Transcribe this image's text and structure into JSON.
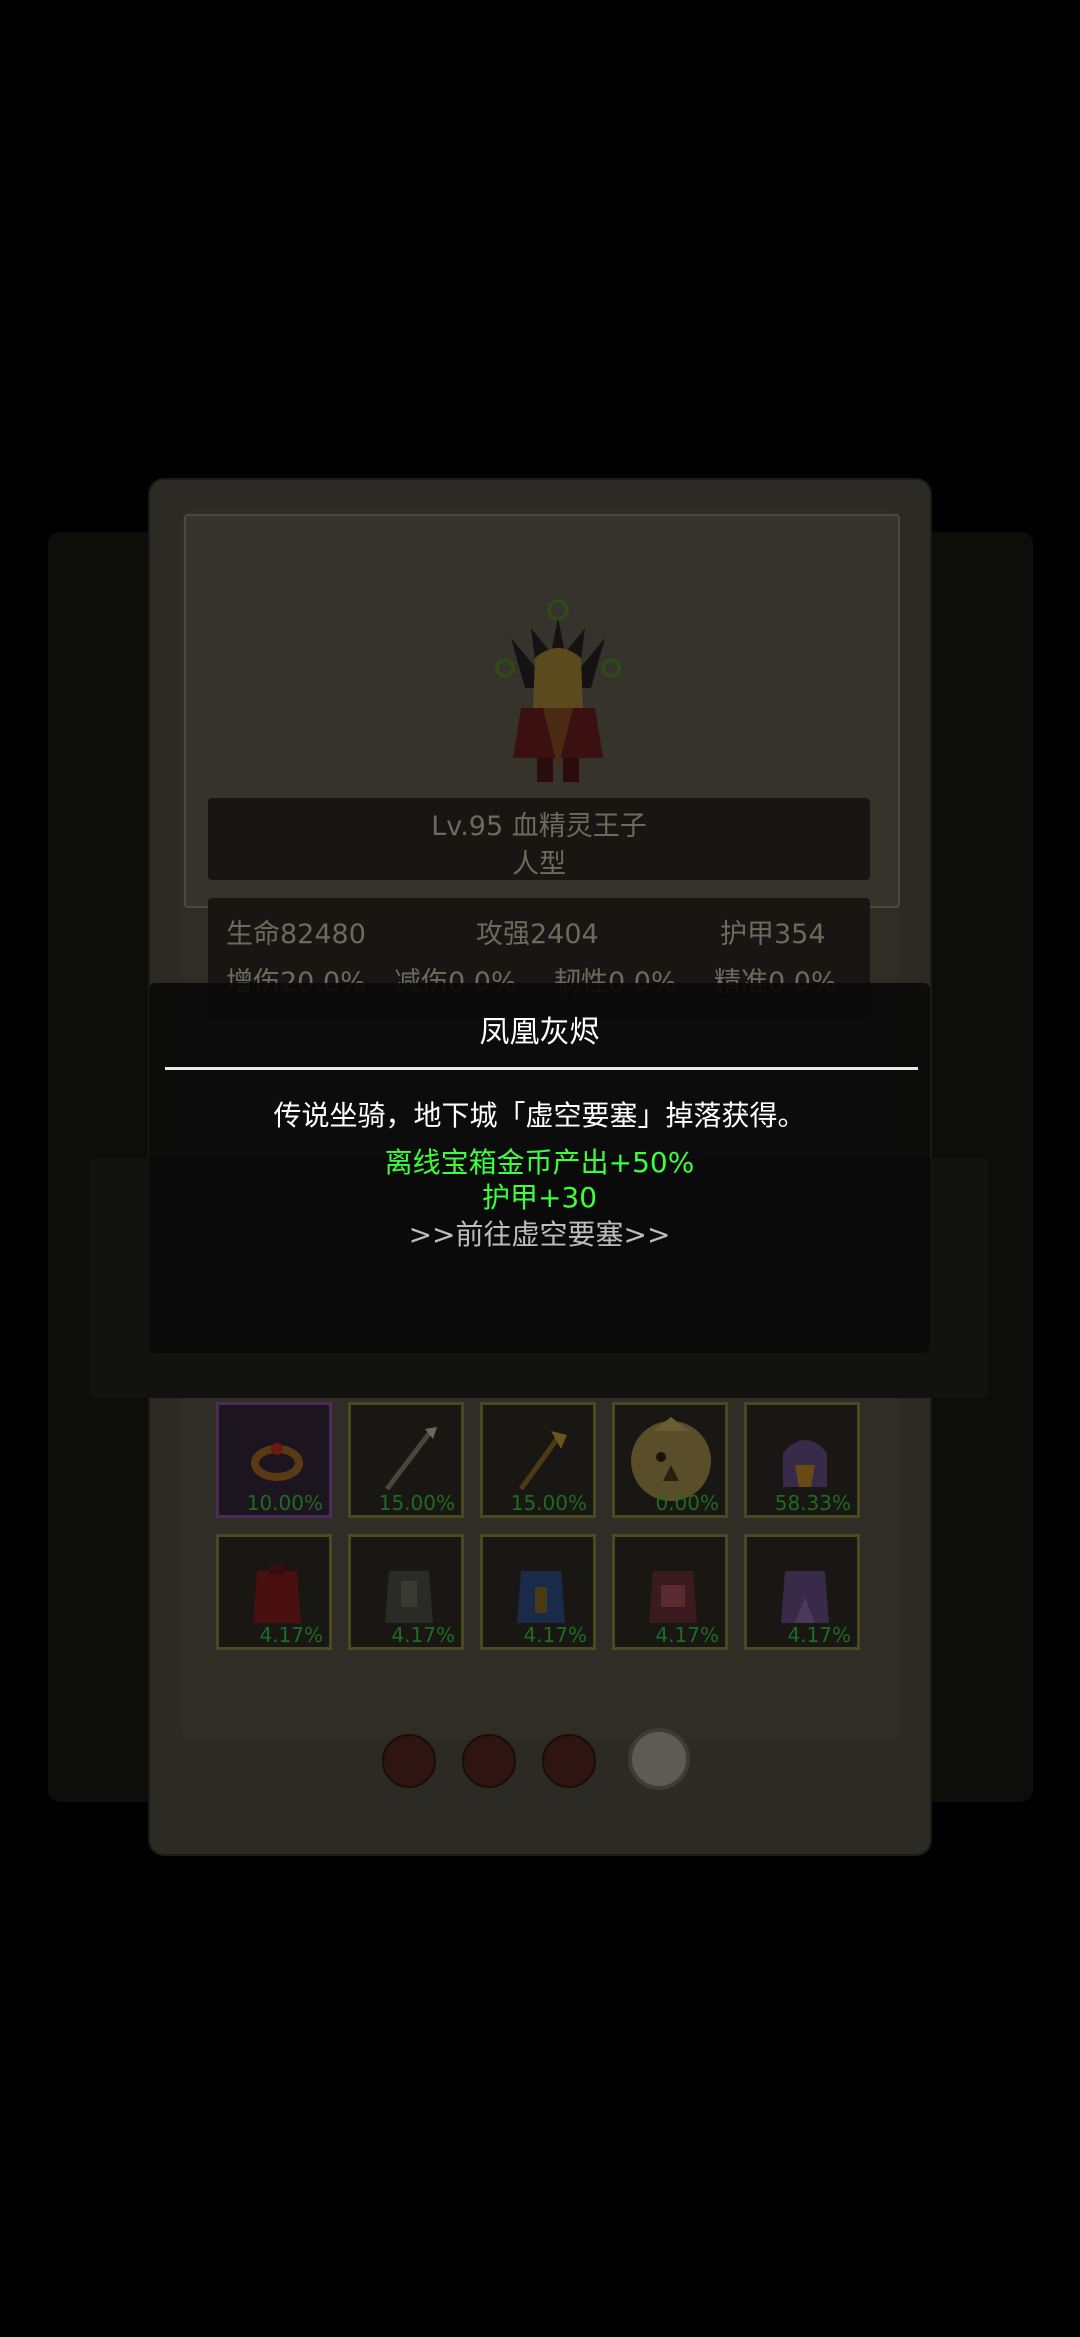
{
  "hero": {
    "name_line": "Lv.95 血精灵王子",
    "type": "人型"
  },
  "stats": {
    "hp": "生命82480",
    "attack": "攻强2404",
    "armor": "护甲354",
    "row2_a": "增伤20.0%",
    "row2_b": "减伤0.0%",
    "row2_c": "韧性0.0%",
    "row2_d": "精准0.0%"
  },
  "equipment": [
    {
      "icon": "ring-icon",
      "percent": "10.00%"
    },
    {
      "icon": "spear-icon",
      "percent": "15.00%"
    },
    {
      "icon": "axe-icon",
      "percent": "15.00%"
    },
    {
      "icon": "phoenix-egg-icon",
      "percent": "0.00%"
    },
    {
      "icon": "helmet-icon",
      "percent": "58.33%"
    },
    {
      "icon": "red-armor-icon",
      "percent": "4.17%"
    },
    {
      "icon": "dark-armor-icon",
      "percent": "4.17%"
    },
    {
      "icon": "blue-armor-icon",
      "percent": "4.17%"
    },
    {
      "icon": "pink-armor-icon",
      "percent": "4.17%"
    },
    {
      "icon": "purple-armor-icon",
      "percent": "4.17%"
    }
  ],
  "popup": {
    "title": "凤凰灰烬",
    "description": "传说坐骑，地下城「虚空要塞」掉落获得。",
    "bonus_1": "离线宝箱金币产出+50%",
    "bonus_2": "护甲+30",
    "link": ">>前往虚空要塞>>"
  },
  "page_indicator": {
    "total": 4,
    "active": 4
  },
  "colors": {
    "bonus_green": "#3cff3c",
    "percent_green": "#1f6b1f",
    "popup_bg": "#0a0a0a"
  }
}
